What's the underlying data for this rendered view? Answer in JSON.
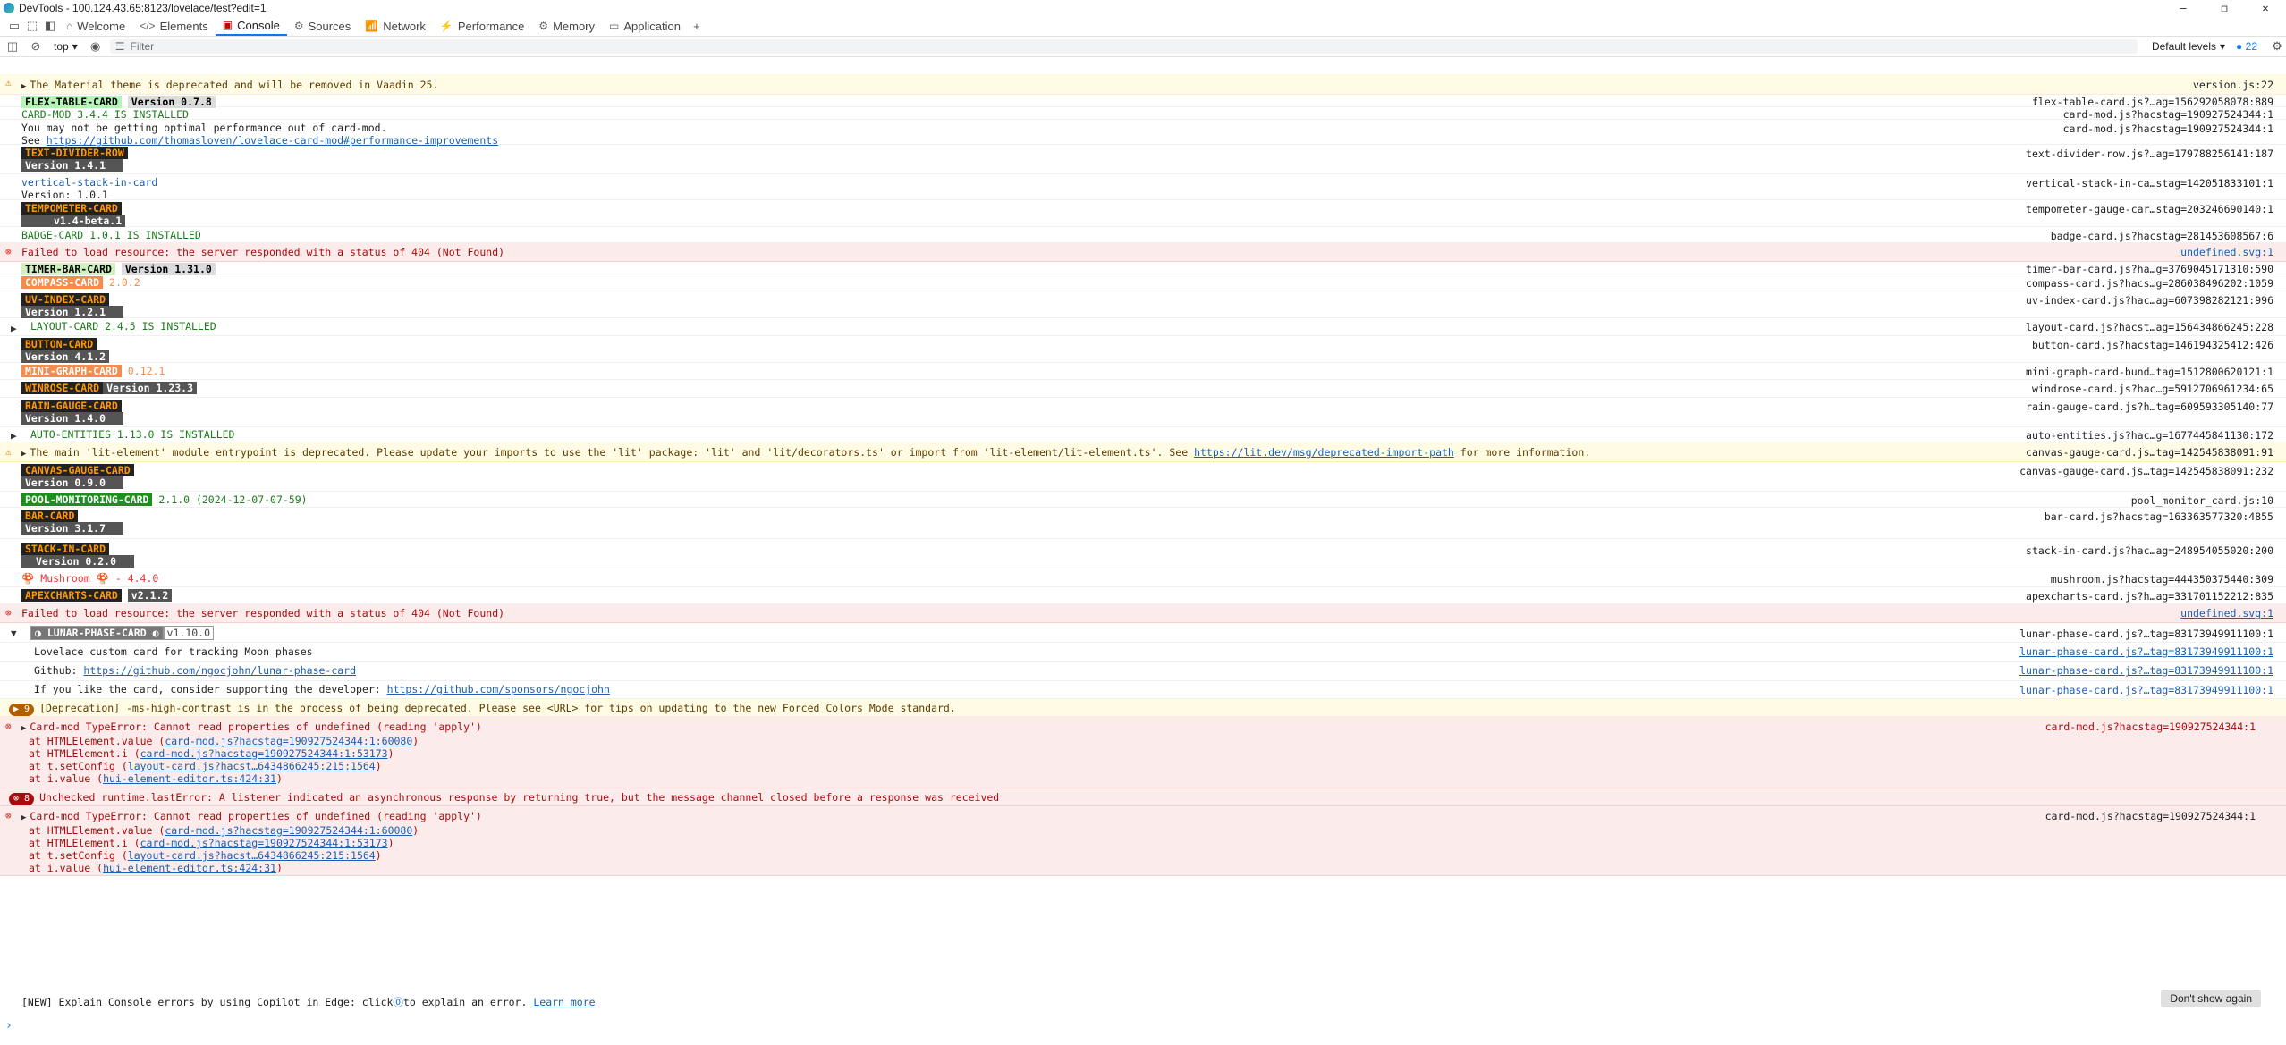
{
  "window": {
    "title": "DevTools - 100.124.43.65:8123/lovelace/test?edit=1"
  },
  "tabs": [
    {
      "label": "Welcome",
      "icon": "⌂"
    },
    {
      "label": "Elements",
      "icon": "</>"
    },
    {
      "label": "Console",
      "icon": "▣"
    },
    {
      "label": "Sources",
      "icon": "⚙"
    },
    {
      "label": "Network",
      "icon": "📶"
    },
    {
      "label": "Performance",
      "icon": "⚡"
    },
    {
      "label": "Memory",
      "icon": "⚙"
    },
    {
      "label": "Application",
      "icon": "▭"
    }
  ],
  "toolbar": {
    "context": "top",
    "filter_placeholder": "Filter",
    "levels": "Default levels",
    "issues_count": "22"
  },
  "rows": {
    "r1": {
      "text": "The Material theme is deprecated and will be removed in Vaadin 25.",
      "src": "version.js:22"
    },
    "r2": {
      "badge": "FLEX-TABLE-CARD",
      "ver": "Version 0.7.8",
      "src": "flex-table-card.js?…ag=156292058078:889"
    },
    "r3": {
      "text": "CARD-MOD 3.4.4 IS INSTALLED",
      "src": "card-mod.js?hacstag=190927524344:1"
    },
    "r4": {
      "line1": "You may not be getting optimal performance out of card-mod.",
      "line2": "See ",
      "link": "https://github.com/thomasloven/lovelace-card-mod#performance-improvements",
      "src": "card-mod.js?hacstag=190927524344:1"
    },
    "r5": {
      "badge": "TEXT-DIVIDER-ROW",
      "ver": "Version 1.4.1",
      "src": "text-divider-row.js?…ag=179788256141:187"
    },
    "r6": {
      "line1": "vertical-stack-in-card",
      "line2": "Version: 1.0.1",
      "src": "vertical-stack-in-ca…stag=142051833101:1"
    },
    "r7": {
      "badge": "TEMPOMETER-CARD",
      "ver": "v1.4-beta.1",
      "src": "tempometer-gauge-car…stag=203246690140:1"
    },
    "r8": {
      "text": "BADGE-CARD 1.0.1 IS INSTALLED",
      "src": "badge-card.js?hacstag=281453608567:6"
    },
    "r9": {
      "text": "Failed to load resource: the server responded with a status of 404 (Not Found)",
      "src": "undefined.svg:1"
    },
    "r10": {
      "badge": "TIMER-BAR-CARD",
      "ver": "Version 1.31.0",
      "src": "timer-bar-card.js?ha…g=3769045171310:590"
    },
    "r11": {
      "badge": "COMPASS-CARD",
      "ver": "2.0.2",
      "src": "compass-card.js?hacs…g=286038496202:1059"
    },
    "r12": {
      "badge": "UV-INDEX-CARD",
      "ver": "Version 1.2.1",
      "src": "uv-index-card.js?hac…ag=607398282121:996"
    },
    "r13": {
      "text": "LAYOUT-CARD 2.4.5 IS INSTALLED",
      "src": "layout-card.js?hacst…ag=156434866245:228"
    },
    "r14": {
      "badge": "BUTTON-CARD",
      "ver": "Version 4.1.2",
      "src": "button-card.js?hacstag=146194325412:426"
    },
    "r15": {
      "badge": "MINI-GRAPH-CARD",
      "ver": "0.12.1",
      "src": "mini-graph-card-bund…tag=1512800620121:1"
    },
    "r16": {
      "badge": "WINROSE-CARD",
      "ver": "Version 1.23.3",
      "src": "windrose-card.js?hac…g=5912706961234:65"
    },
    "r17": {
      "badge": "RAIN-GAUGE-CARD",
      "ver": "Version 1.4.0",
      "src": "rain-gauge-card.js?h…tag=609593305140:77"
    },
    "r18": {
      "text": "AUTO-ENTITIES 1.13.0 IS INSTALLED",
      "src": "auto-entities.js?hac…g=1677445841130:172"
    },
    "r19": {
      "text": "The main 'lit-element' module entrypoint is deprecated. Please update your imports to use the 'lit' package: 'lit' and 'lit/decorators.ts' or import from 'lit-element/lit-element.ts'. See ",
      "link": "https://lit.dev/msg/deprecated-import-path",
      "tail": " for more information.",
      "src": "canvas-gauge-card.js…tag=142545838091:91"
    },
    "r20": {
      "badge": "CANVAS-GAUGE-CARD",
      "ver": "Version 0.9.0",
      "src": "canvas-gauge-card.js…tag=142545838091:232"
    },
    "r21": {
      "badge": "POOL-MONITORING-CARD",
      "ver": "2.1.0 (2024-12-07-07-59)",
      "src": "pool_monitor_card.js:10"
    },
    "r22": {
      "badge": "BAR-CARD",
      "ver": "Version 3.1.7",
      "src": "bar-card.js?hacstag=163363577320:4855"
    },
    "r23": {
      "badge": "STACK-IN-CARD",
      "ver": "Version 0.2.0",
      "src": "stack-in-card.js?hac…ag=248954055020:200"
    },
    "r24": {
      "text": "Mushroom",
      "ver": "- 4.4.0",
      "src": "mushroom.js?hacstag=444350375440:309"
    },
    "r25": {
      "badge": "APEXCHARTS-CARD",
      "ver": "v2.1.2",
      "src": "apexcharts-card.js?h…ag=331701152212:835"
    },
    "r26": {
      "text": "Failed to load resource: the server responded with a status of 404 (Not Found)",
      "src": "undefined.svg:1"
    },
    "r27": {
      "badge": "LUNAR-PHASE-CARD",
      "ver": "v1.10.0",
      "src": "lunar-phase-card.js?…tag=83173949911100:1"
    },
    "r28": {
      "text": "Lovelace custom card for tracking Moon phases",
      "src": "lunar-phase-card.js?…tag=83173949911100:1"
    },
    "r29": {
      "label": "Github: ",
      "link": "https://github.com/ngocjohn/lunar-phase-card",
      "src": "lunar-phase-card.js?…tag=83173949911100:1"
    },
    "r30": {
      "label": "If you like the card, consider supporting the developer: ",
      "link": "https://github.com/sponsors/ngocjohn",
      "src": "lunar-phase-card.js?…tag=83173949911100:1"
    },
    "r31": {
      "count": "9",
      "text": "[Deprecation] -ms-high-contrast is in the process of being deprecated. Please see <URL> for tips on updating to the new Forced Colors Mode standard."
    },
    "r32": {
      "text": "Card-mod TypeError: Cannot read properties of undefined (reading 'apply')",
      "src": "card-mod.js?hacstag=190927524344:1",
      "stack": [
        {
          "pre": "at HTMLElement.value (",
          "link": "card-mod.js?hacstag=190927524344:1:60080",
          "post": ")"
        },
        {
          "pre": "at HTMLElement.i (",
          "link": "card-mod.js?hacstag=190927524344:1:53173",
          "post": ")"
        },
        {
          "pre": "at t.setConfig (",
          "link": "layout-card.js?hacst…6434866245:215:1564",
          "post": ")"
        },
        {
          "pre": "at i.value (",
          "link": "hui-element-editor.ts:424:31",
          "post": ")"
        }
      ]
    },
    "r33": {
      "count": "8",
      "text": "Unchecked runtime.lastError: A listener indicated an asynchronous response by returning true, but the message channel closed before a response was received"
    },
    "r34": {
      "text": "Card-mod TypeError: Cannot read properties of undefined (reading 'apply')",
      "src": "card-mod.js?hacstag=190927524344:1",
      "stack": [
        {
          "pre": "at HTMLElement.value (",
          "link": "card-mod.js?hacstag=190927524344:1:60080",
          "post": ")"
        },
        {
          "pre": "at HTMLElement.i (",
          "link": "card-mod.js?hacstag=190927524344:1:53173",
          "post": ")"
        },
        {
          "pre": "at t.setConfig (",
          "link": "layout-card.js?hacst…6434866245:215:1564",
          "post": ")"
        },
        {
          "pre": "at i.value (",
          "link": "hui-element-editor.ts:424:31",
          "post": ")"
        }
      ]
    }
  },
  "infobar": {
    "text": "[NEW] Explain Console errors by using Copilot in Edge: click ",
    "text2": " to explain an error.",
    "link": "Learn more",
    "button": "Don't show again"
  },
  "prompt": "›"
}
